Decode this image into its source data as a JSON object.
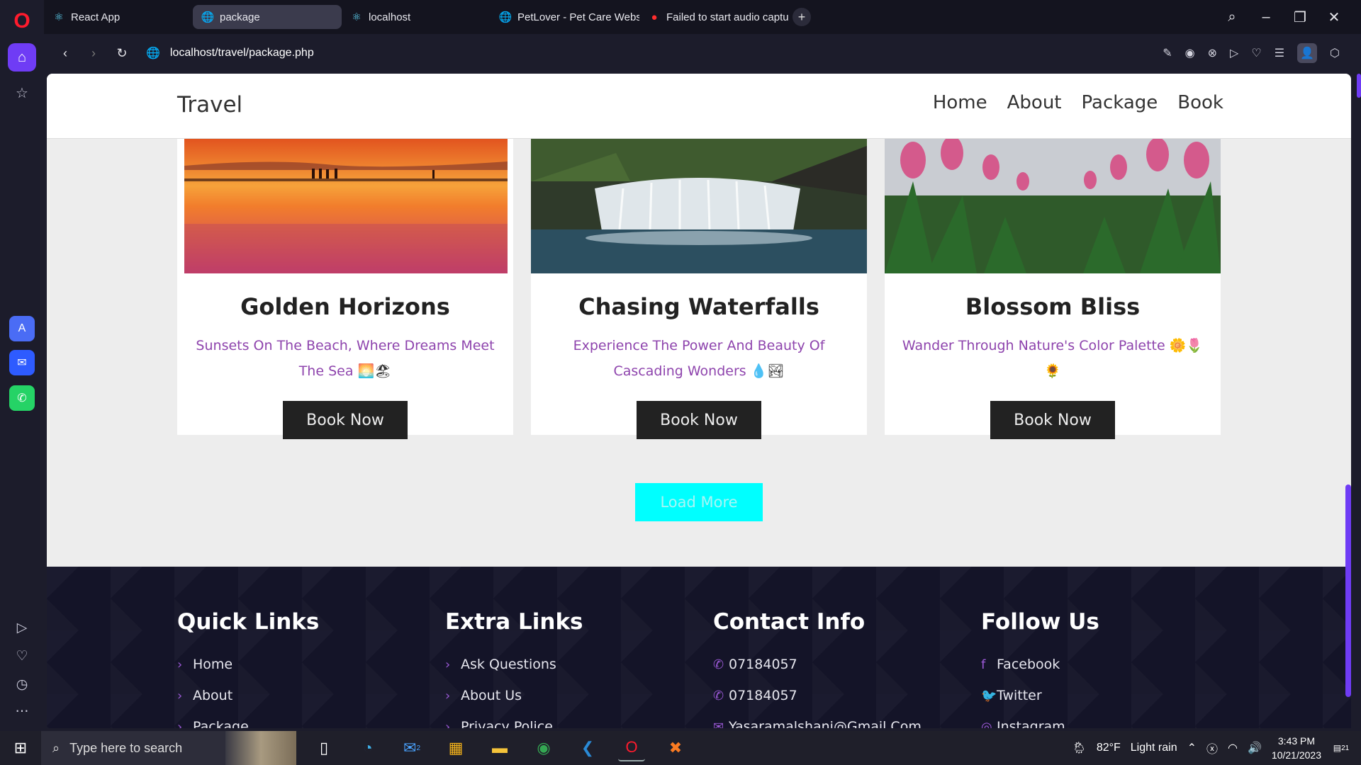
{
  "browser": {
    "tabs": [
      {
        "label": "React App",
        "icon": "react-icon",
        "active": false
      },
      {
        "label": "package",
        "icon": "globe-icon",
        "active": true
      },
      {
        "label": "localhost",
        "icon": "react-icon",
        "active": false
      },
      {
        "label": "PetLover - Pet Care Websi",
        "icon": "globe-icon",
        "active": false
      },
      {
        "label": "Failed to start audio captu",
        "icon": "record-icon",
        "active": false
      }
    ],
    "url": "localhost/travel/package.php"
  },
  "site": {
    "logo": "Travel",
    "menu": [
      "Home",
      "About",
      "Package",
      "Book"
    ]
  },
  "packages": [
    {
      "title": "Golden Horizons",
      "desc": "Sunsets On The Beach, Where Dreams Meet The Sea",
      "emoji": "🌅🏖",
      "button": "Book Now"
    },
    {
      "title": "Chasing Waterfalls",
      "desc": "Experience The Power And Beauty Of Cascading Wonders",
      "emoji": "💧🏞",
      "button": "Book Now"
    },
    {
      "title": "Blossom Bliss",
      "desc": "Wander Through Nature's Color Palette",
      "emoji": "🌼🌷🌻",
      "button": "Book Now"
    }
  ],
  "load_more": "Load More",
  "footer": {
    "quick_links": {
      "title": "Quick Links",
      "items": [
        "Home",
        "About",
        "Package"
      ]
    },
    "extra_links": {
      "title": "Extra Links",
      "items": [
        "Ask Questions",
        "About Us",
        "Privacy Police"
      ]
    },
    "contact": {
      "title": "Contact Info",
      "items": [
        "07184057",
        "07184057",
        "Yasaramalshani@Gmail.Com"
      ]
    },
    "follow": {
      "title": "Follow Us",
      "items": [
        "Facebook",
        "Twitter",
        "Instagram"
      ]
    }
  },
  "taskbar": {
    "search_placeholder": "Type here to search",
    "weather_temp": "82°F",
    "weather_desc": "Light rain",
    "time": "3:43 PM",
    "date": "10/21/2023",
    "notifications": "21",
    "mail_badge": "2"
  },
  "colors": {
    "accent": "#8e44ad",
    "load_more": "#00ffff",
    "opera_violet": "#6f3cf5"
  }
}
